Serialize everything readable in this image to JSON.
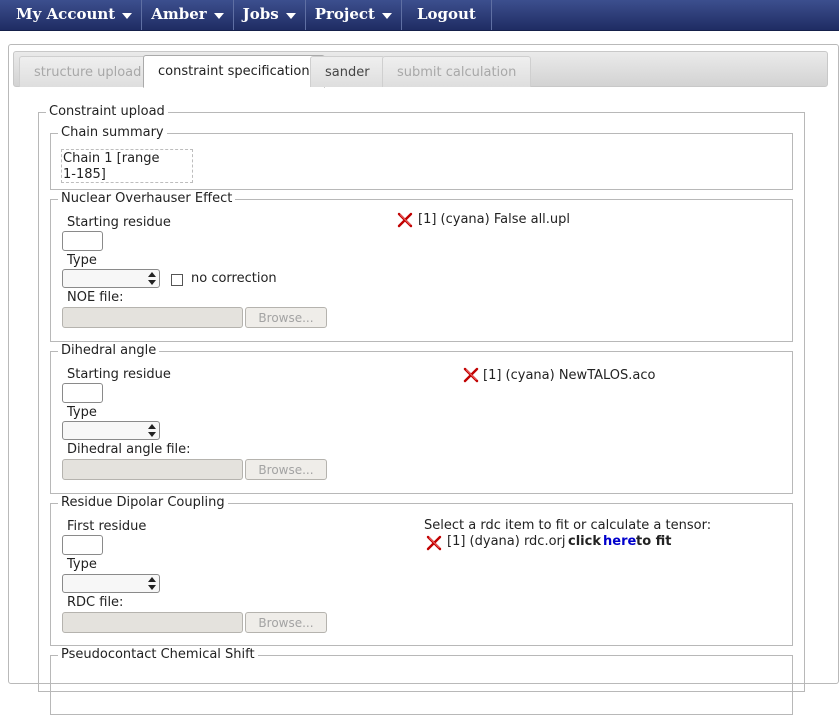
{
  "menu": {
    "items": [
      {
        "label": "My Account",
        "has_dropdown": true
      },
      {
        "label": "Amber",
        "has_dropdown": true
      },
      {
        "label": "Jobs",
        "has_dropdown": true
      },
      {
        "label": "Project",
        "has_dropdown": true
      },
      {
        "label": "Logout",
        "has_dropdown": false
      }
    ]
  },
  "tabs": [
    {
      "label": "structure upload",
      "state": "disabled"
    },
    {
      "label": "constraint specification",
      "state": "active"
    },
    {
      "label": "sander",
      "state": "enabled"
    },
    {
      "label": "submit calculation",
      "state": "disabled"
    }
  ],
  "constraint_upload": {
    "legend": "Constraint upload",
    "chain_summary": {
      "legend": "Chain summary",
      "line1": "Chain 1 [range",
      "line2": "1-185]"
    },
    "noe": {
      "legend": "Nuclear Overhauser Effect",
      "starting_residue_label": "Starting residue",
      "type_label": "Type",
      "no_correction_label": "no correction",
      "file_label": "NOE file:",
      "browse_label": "Browse...",
      "entry": "[1] (cyana) False all.upl"
    },
    "dihedral": {
      "legend": "Dihedral angle",
      "starting_residue_label": "Starting residue",
      "type_label": "Type",
      "file_label": "Dihedral angle file:",
      "browse_label": "Browse...",
      "entry": "[1] (cyana) NewTALOS.aco"
    },
    "rdc": {
      "legend": "Residue Dipolar Coupling",
      "first_residue_label": "First residue",
      "type_label": "Type",
      "file_label": "RDC file:",
      "browse_label": "Browse...",
      "hint": "Select a rdc item to fit or calculate a tensor:",
      "entry": "[1] (dyana) rdc.orj",
      "click_label": "click",
      "here_label": "here",
      "to_fit_label": "to fit"
    },
    "pcs": {
      "legend": "Pseudocontact Chemical Shift"
    }
  },
  "colors": {
    "menubar_top": "#3c4f8e",
    "menubar_bottom": "#1f2c63",
    "link": "#0000cc",
    "delete_icon": "#c00000"
  },
  "icons": {
    "delete": "red-x-delete-icon"
  }
}
